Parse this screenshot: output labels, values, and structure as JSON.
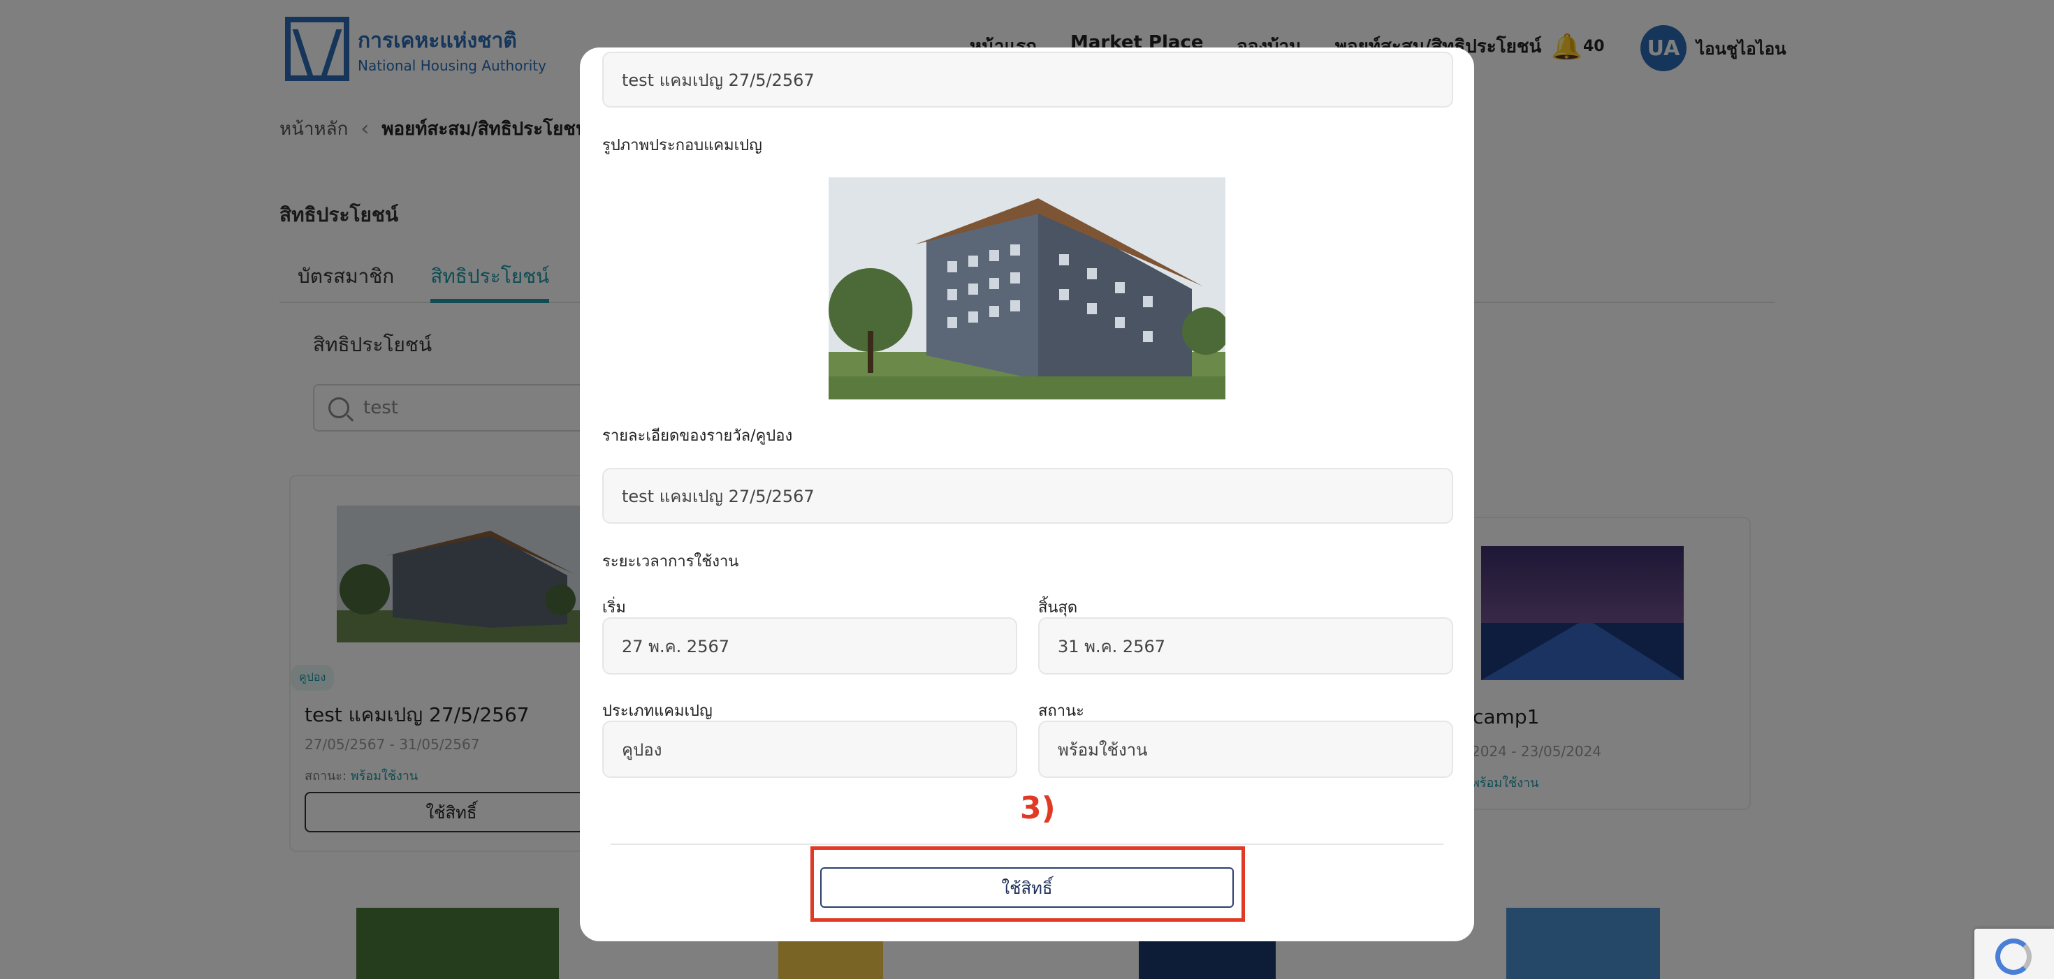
{
  "header": {
    "logo_th": "การเคหะแห่งชาติ",
    "logo_en": "National Housing Authority",
    "nav": [
      "หน้าแรก",
      "Market Place",
      "จองบ้าน",
      "พอยท์สะสม/สิทธิประโยชน์"
    ],
    "notification_count": "40",
    "avatar_initials": "UA",
    "user_name": "ไอนชูไอไอน"
  },
  "breadcrumb": {
    "home": "หน้าหลัก",
    "current": "พอยท์สะสม/สิทธิประโยชน์"
  },
  "page": {
    "section_title": "สิทธิประโยชน์",
    "tabs": [
      {
        "label": "บัตรสมาชิก",
        "active": false
      },
      {
        "label": "สิทธิประโยชน์",
        "active": true
      }
    ],
    "sub_title": "สิทธิประโยชน์",
    "search_value": "test"
  },
  "cards": [
    {
      "badge": "คูปอง",
      "title": "test แคมเปญ 27/5/2567",
      "date": "27/05/2567 - 31/05/2567",
      "status_label": "สถานะ:",
      "status_value": "พร้อมใช้งาน",
      "button": "ใช้สิทธิ์"
    },
    {
      "title": "camp1",
      "date": "2024 - 23/05/2024",
      "status_value": "พร้อมใช้งาน"
    }
  ],
  "modal": {
    "name_value": "test แคมเปญ 27/5/2567",
    "image_label": "รูปภาพประกอบแคมเปญ",
    "detail_label": "รายละเอียดของรายวัล/คูปอง",
    "detail_value": "test แคมเปญ 27/5/2567",
    "period_label": "ระยะเวลาการใช้งาน",
    "start_label": "เริ่ม",
    "start_value": "27 พ.ค. 2567",
    "end_label": "สิ้นสุด",
    "end_value": "31 พ.ค. 2567",
    "type_label": "ประเภทแคมเปญ",
    "type_value": "คูปอง",
    "status_label": "สถานะ",
    "status_value": "พร้อมใช้งาน",
    "annotation": "3)",
    "use_button": "ใช้สิทธิ์"
  },
  "colors": {
    "brand_blue": "#2a6db5",
    "accent_teal": "#1f9aa6",
    "annotation_red": "#e03a25",
    "button_navy": "#1d2f5a"
  }
}
